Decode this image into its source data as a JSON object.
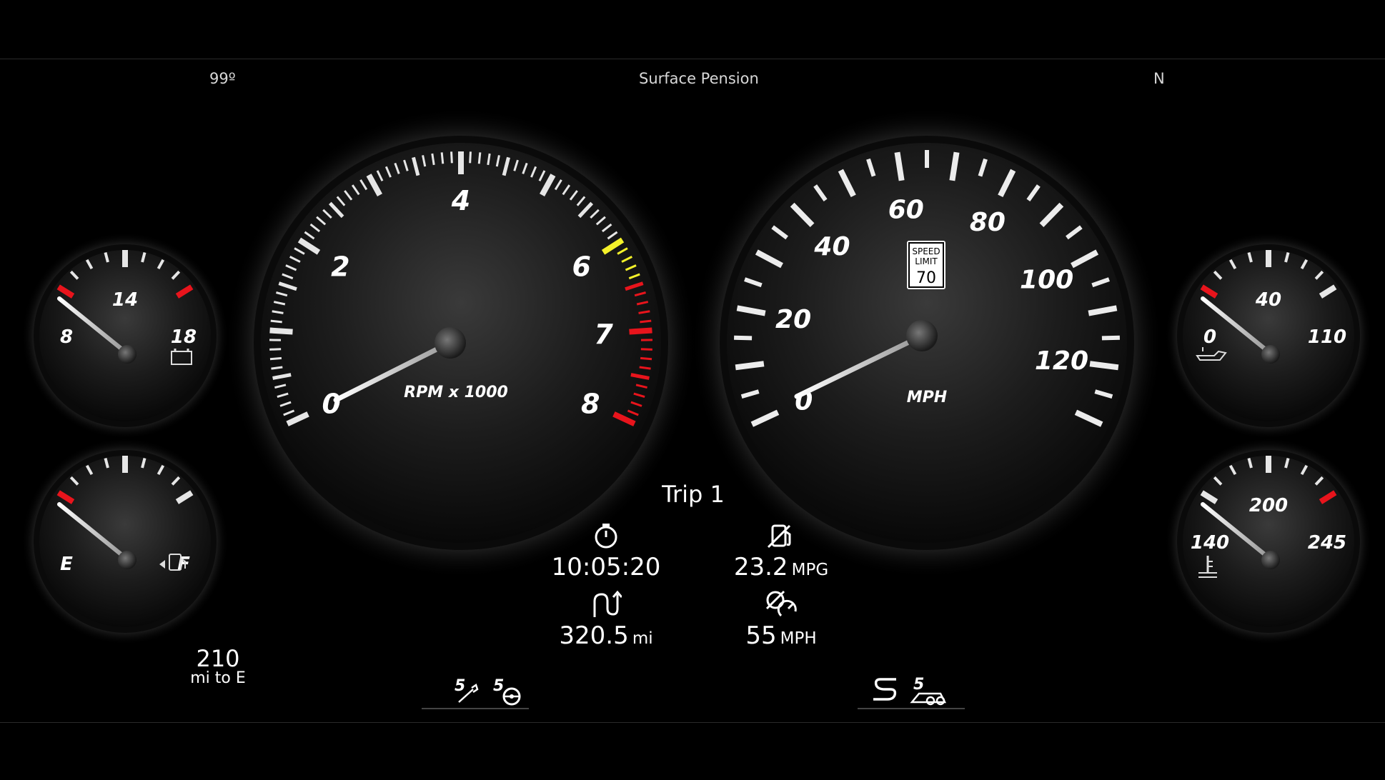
{
  "status_bar": {
    "temperature": "99º",
    "location": "Surface Pension",
    "heading": "N"
  },
  "tachometer": {
    "scale_labels": [
      "0",
      "2",
      "4",
      "6",
      "7",
      "8"
    ],
    "unit_label": "RPM x 1000",
    "value_rpm_x1000": 0,
    "redline_start": 6
  },
  "speedometer": {
    "scale_labels": [
      "0",
      "20",
      "40",
      "60",
      "80",
      "100",
      "120"
    ],
    "unit_label": "MPH",
    "value_mph": 0,
    "speed_limit_sign": {
      "line1": "SPEED",
      "line2": "LIMIT",
      "value": "70"
    }
  },
  "voltage_gauge": {
    "labels": [
      "8",
      "14",
      "18"
    ],
    "icon": "battery-icon"
  },
  "fuel_gauge": {
    "labels": [
      "E",
      "F"
    ],
    "icon": "fuel-pump-icon"
  },
  "oil_pressure_gauge": {
    "labels": [
      "0",
      "40",
      "110"
    ],
    "icon": "oil-can-icon"
  },
  "coolant_temp_gauge": {
    "labels": [
      "140",
      "200",
      "245"
    ],
    "icon": "coolant-temp-icon"
  },
  "trip": {
    "title": "Trip 1",
    "elapsed_time": "10:05:20",
    "fuel_economy_value": "23.2",
    "fuel_economy_unit": "MPG",
    "distance_value": "320.5",
    "distance_unit": "mi",
    "avg_speed_value": "55",
    "avg_speed_unit": "MPH"
  },
  "range": {
    "value": "210",
    "label": "mi to E"
  },
  "mode_icons": [
    "drive-mode-wrench-icon",
    "drive-mode-steering-icon",
    "drive-mode-sport-icon",
    "drive-mode-track-icon"
  ],
  "colors": {
    "redline": "#e8141c",
    "yellow_zone": "#f4f12a",
    "background": "#000000"
  }
}
